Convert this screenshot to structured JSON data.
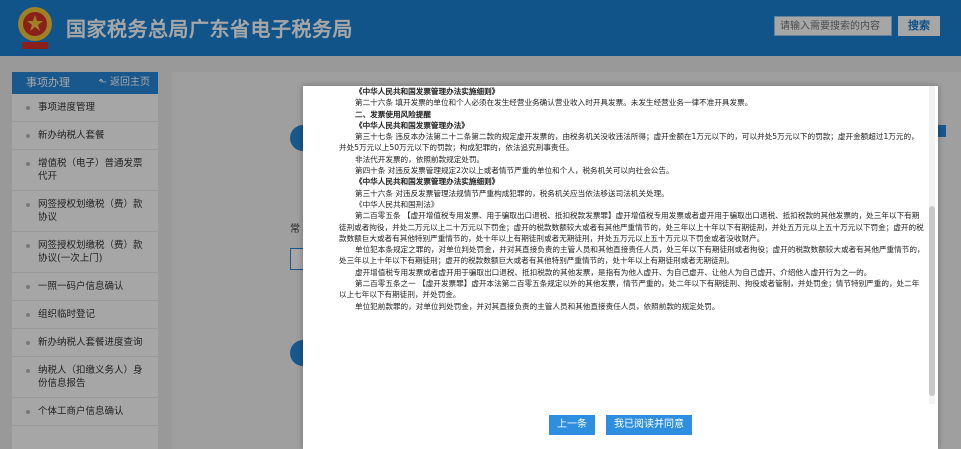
{
  "header": {
    "title": "国家税务总局广东省电子税务局",
    "search_placeholder": "请输入需要搜索的内容",
    "search_button": "搜索",
    "brand_color": "#1a82d4"
  },
  "sidebar": {
    "title": "事项办理",
    "back_label": "返回主页",
    "items": [
      {
        "label": "事项进度管理"
      },
      {
        "label": "新办纳税人套餐"
      },
      {
        "label": "增值税（电子）普通发票代开"
      },
      {
        "label": "网签授权划缴税（费）款协议"
      },
      {
        "label": "网签授权划缴税（费）款协议(一次上门)"
      },
      {
        "label": "一照一码户信息确认"
      },
      {
        "label": "组织临时登记"
      },
      {
        "label": "新办纳税人套餐进度查询"
      },
      {
        "label": "纳税人（扣缴义务人）身份信息报告"
      },
      {
        "label": "个体工商户信息确认"
      }
    ]
  },
  "background": {
    "label": "常"
  },
  "modal": {
    "lines": [
      {
        "t": "《中华人民共和国发票管理办法实施细则》",
        "s": "h"
      },
      {
        "t": "第二十六条 填开发票的单位和个人必须在发生经营业务确认营业收入时开具发票。未发生经营业务一律不准开具发票。",
        "s": "ind"
      },
      {
        "t": "二、发票使用风险提醒",
        "s": "h"
      },
      {
        "t": "《中华人民共和国发票管理办法》",
        "s": "h"
      },
      {
        "t": "第三十七条 违反本办法第二十二条第二款的规定虚开发票的，由税务机关没收违法所得；虚开金额在1万元以下的，可以并处5万元以下的罚款；虚开金额超过1万元的，并处5万元以上50万元以下的罚款；构成犯罪的，依法追究刑事责任。",
        "s": "ind"
      },
      {
        "t": "非法代开发票的，依照前款规定处罚。",
        "s": "ind"
      },
      {
        "t": "第四十条 对违反发票管理规定2次以上或者情节严重的单位和个人，税务机关可以向社会公告。",
        "s": "ind"
      },
      {
        "t": "《中华人民共和国发票管理办法实施细则》",
        "s": "h"
      },
      {
        "t": "第三十六条 对违反发票管理法规情节严重构成犯罪的，税务机关应当依法移送司法机关处理。",
        "s": "ind"
      },
      {
        "t": "《中华人民共和国刑法》",
        "s": "ind"
      },
      {
        "t": "第二百零五条 【虚开增值税专用发票、用于骗取出口退税、抵扣税款发票罪】虚开增值税专用发票或者虚开用于骗取出口退税、抵扣税款的其他发票的，处三年以下有期徒刑或者拘役，并处二万元以上二十万元以下罚金；虚开的税款数额较大或者有其他严重情节的，处三年以上十年以下有期徒刑，并处五万元以上五十万元以下罚金；虚开的税款数额巨大或者有其他特别严重情节的，处十年以上有期徒刑或者无期徒刑，并处五万元以上五十万元以下罚金或者没收财产。",
        "s": "ind"
      },
      {
        "t": "单位犯本条规定之罪的，对单位判处罚金，并对其直接负责的主管人员和其他直接责任人员，处三年以下有期徒刑或者拘役；虚开的税款数额较大或者有其他严重情节的，处三年以上十年以下有期徒刑；虚开的税款数额巨大或者有其他特别严重情节的，处十年以上有期徒刑或者无期徒刑。",
        "s": "ind"
      },
      {
        "t": "虚开增值税专用发票或者虚开用于骗取出口退税、抵扣税款的其他发票，是指有为他人虚开、为自己虚开、让他人为自己虚开、介绍他人虚开行为之一的。",
        "s": "ind"
      },
      {
        "t": "第二百零五条之一 【虚开发票罪】虚开本法第二百零五条规定以外的其他发票，情节严重的，处二年以下有期徒刑、拘役或者管制，并处罚金；情节特别严重的，处二年以上七年以下有期徒刑，并处罚金。",
        "s": "ind"
      },
      {
        "t": "单位犯前款罪的，对单位判处罚金，并对其直接负责的主管人员和其他直接责任人员，依照前款的规定处罚。",
        "s": "ind"
      }
    ],
    "prev_button": "上一条",
    "agree_button": "我已阅读并同意",
    "button_color": "#2e8fe0"
  }
}
